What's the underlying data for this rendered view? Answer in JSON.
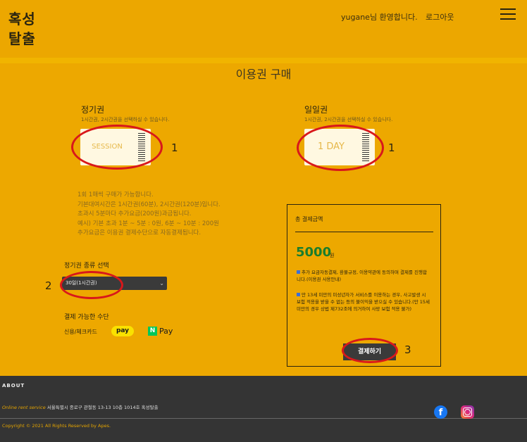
{
  "header": {
    "logo_line1": "혹성",
    "logo_line2": "탈출",
    "welcome": "yugane님 환영합니다.",
    "logout": "로그아웃",
    "menu_icon": "hamburger-icon"
  },
  "page_title": "이용권 구매",
  "season": {
    "title": "정기권",
    "subtitle": "1시간권, 2시간권을 선택하실 수 있습니다.",
    "ticket_label": "SESSION",
    "annotation": "1"
  },
  "daily": {
    "title": "일일권",
    "subtitle": "1시간권, 2시간권을 선택하실 수 있습니다.",
    "ticket_label": "1 DAY",
    "annotation": "1"
  },
  "info_lines": [
    "1회 1매씩 구매가 가능합니다.",
    "기본대여시간은 1시간권(60분), 2시간권(120분)입니다.",
    "초과시 5분마다 추가요금(200원)과금됩니다.",
    "예시) 기본 초과 1분 ~ 5분 : 0원, 6분 ~ 10분 : 200원",
    "추가요금은 이용권 결제수단으로 자동결제됩니다."
  ],
  "select_section": {
    "label": "정기권 종류 선택",
    "selected": "30일(1시간권)",
    "annotation": "2"
  },
  "payment": {
    "label": "결제 가능한 수단",
    "card": "신용/체크카드",
    "kakaopay": "pay",
    "npay_box": "N",
    "npay_text": "Pay"
  },
  "summary": {
    "title": "총 결제금액",
    "amount": "5000",
    "currency": "원",
    "terms1": "추가 요금자동결제, 환불규정, 이용약관에 동의하며 결제를 진행합니다.(이용권 사용안내)",
    "terms2": "만 13세 미만의 미성년자가 서비스를 이용하는 경우, 사고발생 시 보험 적용을 받을 수 없는 등의 불이익을 받으실 수 있습니다.(만 15세 미만의 경우 상법 제732조에 의거하여 사망 보험 적용 불가)",
    "pay_button": "결제하기",
    "annotation": "3"
  },
  "footer": {
    "about": "ABOUT",
    "service": "Online rent service",
    "address": " 서울특별시 종로구 관철동 13-13 10층 1014호 혹성탈출",
    "copyright": "Copyright © 2021 All Rights Reserved by Apes.",
    "facebook_icon": "facebook-icon",
    "instagram_icon": "instagram-icon"
  }
}
